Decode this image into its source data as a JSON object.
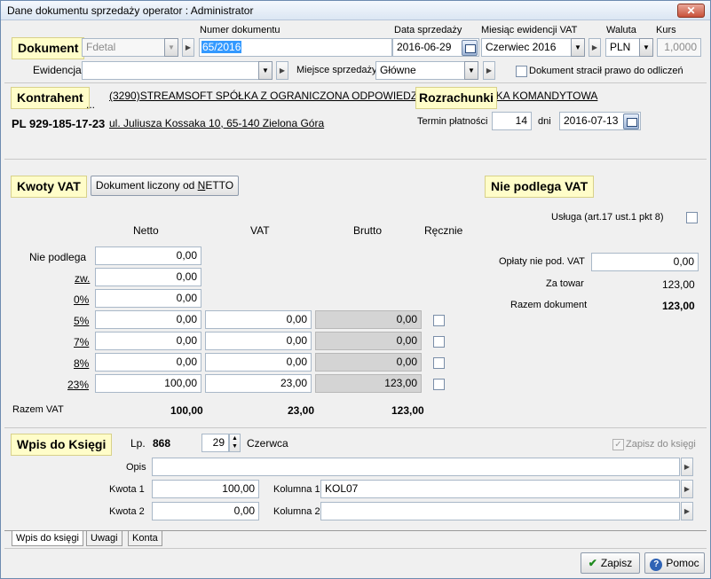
{
  "window": {
    "title": "Dane dokumentu sprzedaży    operator : Administrator",
    "close": "✕"
  },
  "header": {
    "dokument_label": "Dokument",
    "doc_type": "Fdetal",
    "numer_label": "Numer dokumentu",
    "numer_value": "65/2016",
    "data_label": "Data sprzedaży",
    "data_value": "2016-06-29",
    "miesiac_label": "Miesiąc ewidencji VAT",
    "miesiac_value": "Czerwiec 2016",
    "waluta_label": "Waluta",
    "waluta_value": "PLN",
    "kurs_label": "Kurs",
    "kurs_value": "1,0000",
    "ewidencja_label": "Ewidencja",
    "ewidencja_value": "",
    "miejsce_label": "Miejsce sprzedaży",
    "miejsce_value": "Główne",
    "stracil_label": "Dokument stracił prawo do odliczeń"
  },
  "kontrahent": {
    "label": "Kontrahent",
    "ellipsis": "...",
    "name": "(3290)STREAMSOFT SPÓŁKA Z OGRANICZONA ODPOWIEDZI",
    "name_tail": "ŁKA KOMANDYTOWA",
    "rozrachunki": "Rozrachunki",
    "nip": "PL 929-185-17-23",
    "address": "ul. Juliusza Kossaka 10, 65-140 Zielona Góra",
    "termin_label": "Termin płatności",
    "termin_days": "14",
    "dni_label": "dni",
    "termin_date": "2016-07-13"
  },
  "vat": {
    "label": "Kwoty VAT",
    "liczony_button": "Dokument liczony od NETTO",
    "col_netto": "Netto",
    "col_vat": "VAT",
    "col_brutto": "Brutto",
    "col_recznie": "Ręcznie",
    "rows": [
      {
        "label": "Nie podlega",
        "netto": "0,00"
      },
      {
        "label": "zw.",
        "netto": "0,00"
      },
      {
        "label": "0%",
        "netto": "0,00"
      },
      {
        "label": "5%",
        "netto": "0,00",
        "vat": "0,00",
        "brutto": "0,00"
      },
      {
        "label": "7%",
        "netto": "0,00",
        "vat": "0,00",
        "brutto": "0,00"
      },
      {
        "label": "8%",
        "netto": "0,00",
        "vat": "0,00",
        "brutto": "0,00"
      },
      {
        "label": "23%",
        "netto": "100,00",
        "vat": "23,00",
        "brutto": "123,00"
      }
    ],
    "razem_label": "Razem VAT",
    "razem_netto": "100,00",
    "razem_vat": "23,00",
    "razem_brutto": "123,00"
  },
  "nie_podlega": {
    "label": "Nie podlega VAT",
    "usluga_label": "Usługa (art.17 ust.1 pkt 8)",
    "oplaty_label": "Opłaty nie pod. VAT",
    "oplaty_value": "0,00",
    "za_towar_label": "Za towar",
    "za_towar_value": "123,00",
    "razem_label": "Razem dokument",
    "razem_value": "123,00"
  },
  "ksiega": {
    "label": "Wpis do Księgi",
    "lp_label": "Lp.",
    "lp_value": "868",
    "day_value": "29",
    "month": "Czerwca",
    "zapisz_label": "Zapisz do księgi",
    "opis_label": "Opis",
    "opis_value": "",
    "kwota1_label": "Kwota 1",
    "kwota1_value": "100,00",
    "kolumna1_label": "Kolumna 1",
    "kolumna1_value": "KOL07",
    "kwota2_label": "Kwota 2",
    "kwota2_value": "0,00",
    "kolumna2_label": "Kolumna 2",
    "kolumna2_value": ""
  },
  "tabs": [
    "Wpis do księgi",
    "Uwagi",
    "Konta"
  ],
  "footer": {
    "zapisz": "Zapisz",
    "pomoc": "Pomoc"
  }
}
